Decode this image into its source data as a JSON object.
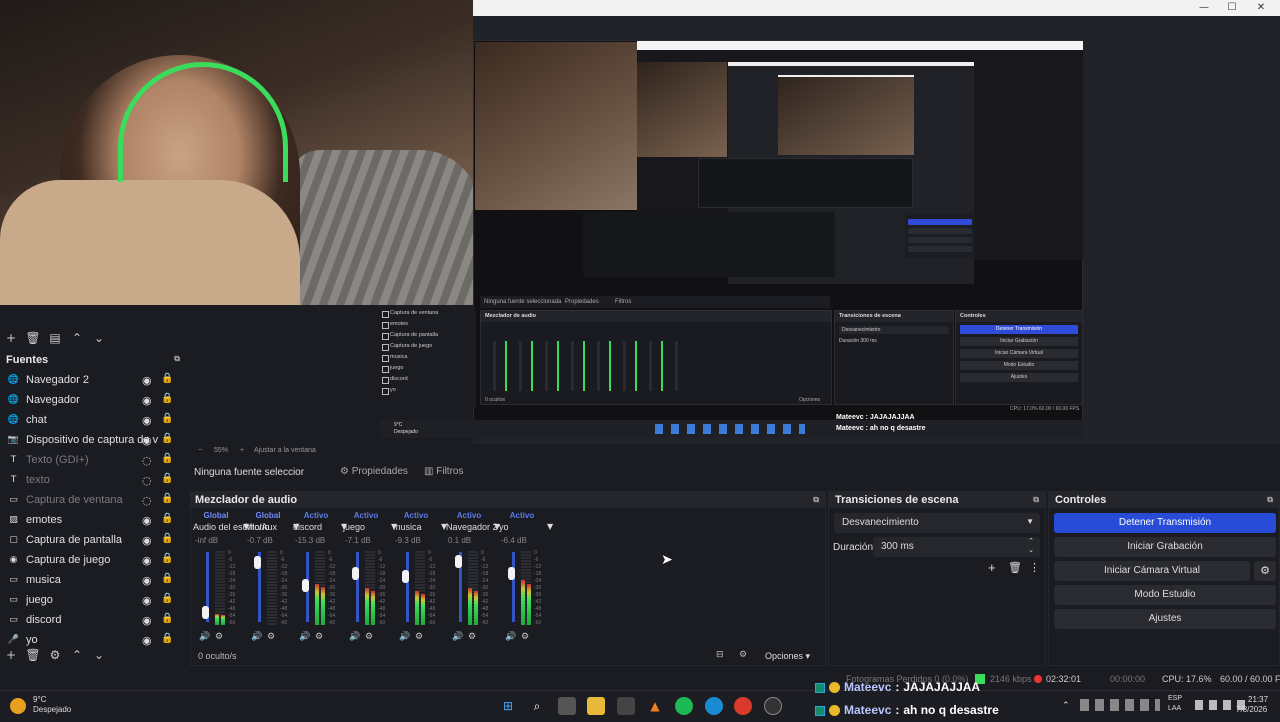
{
  "window": {
    "controls": {
      "minimize": "—",
      "maximize": "☐",
      "close": "✕"
    }
  },
  "preview": {
    "zoom_label": "55%",
    "fit_label": "Ajustar a la ventana"
  },
  "mini": {
    "no_source": "Ninguna fuente seleccionada",
    "properties": "Propiedades",
    "filters": "Filtros",
    "mixer_title": "Mezclador de audio",
    "trans_title": "Transiciones de escena",
    "trans_value": "Desvanecimiento",
    "duration": "Duración",
    "duration_value": "300 ms",
    "controls_title": "Controles",
    "controls": [
      "Detener Transmisión",
      "Iniciar Grabación",
      "Iniciar Cámara Virtual",
      "Modo Estudio",
      "Ajustes"
    ],
    "sources": [
      "Captura de ventana",
      "emotes",
      "Captura de pantalla",
      "Captura de juego",
      "musica",
      "juego",
      "discord",
      "yo"
    ],
    "hidden": "0 ocultos",
    "options": "Opciones",
    "status": "CPU: 17.0%   60.00 / 60.00 FPS",
    "weather": "9°C",
    "weather_desc": "Despejado",
    "chat": [
      {
        "user": "Mateevc",
        "msg": "JAJAJAJJAA"
      },
      {
        "user": "Mateevc",
        "msg": "ah no q desastre"
      }
    ]
  },
  "sources": {
    "title": "Fuentes",
    "items": [
      {
        "name": "Navegador 2",
        "icon": "globe-icon",
        "dim": false
      },
      {
        "name": "Navegador",
        "icon": "globe-icon",
        "dim": false
      },
      {
        "name": "chat",
        "icon": "globe-icon",
        "dim": false
      },
      {
        "name": "Dispositivo de captura de video",
        "icon": "camera-icon",
        "dim": false
      },
      {
        "name": "Texto (GDI+)",
        "icon": "text-icon",
        "dim": true
      },
      {
        "name": "texto",
        "icon": "text-icon",
        "dim": true
      },
      {
        "name": "Captura de ventana",
        "icon": "window-icon",
        "dim": true
      },
      {
        "name": "emotes",
        "icon": "image-icon",
        "dim": false
      },
      {
        "name": "Captura de pantalla",
        "icon": "monitor-icon",
        "dim": false
      },
      {
        "name": "Captura de juego",
        "icon": "gamepad-icon",
        "dim": false
      },
      {
        "name": "musica",
        "icon": "window-icon",
        "dim": false
      },
      {
        "name": "juego",
        "icon": "window-icon",
        "dim": false
      },
      {
        "name": "discord",
        "icon": "window-icon",
        "dim": false
      },
      {
        "name": "yo",
        "icon": "mic-icon",
        "dim": false
      }
    ]
  },
  "propbar": {
    "no_source": "Ninguna fuente seleccionada",
    "properties": "Propiedades",
    "filters": "Filtros"
  },
  "mixer": {
    "title": "Mezclador de audio",
    "channels": [
      {
        "tag": "Global",
        "label": "Audio del escritorio",
        "db": "-inf dB",
        "level": 0.15,
        "fader": 0.1
      },
      {
        "tag": "Global",
        "label": "Mic/Aux",
        "db": "-0.7 dB",
        "level": 0.0,
        "fader": 0.93
      },
      {
        "tag": "Activo",
        "label": "discord",
        "db": "-15.3 dB",
        "level": 0.55,
        "fader": 0.55
      },
      {
        "tag": "Activo",
        "label": "juego",
        "db": "-7.1 dB",
        "level": 0.5,
        "fader": 0.75
      },
      {
        "tag": "Activo",
        "label": "musica",
        "db": "-9.3 dB",
        "level": 0.45,
        "fader": 0.7
      },
      {
        "tag": "Activo",
        "label": "Navegador 2",
        "db": "0.1 dB",
        "level": 0.5,
        "fader": 0.95
      },
      {
        "tag": "Activo",
        "label": "yo",
        "db": "-6.4 dB",
        "level": 0.6,
        "fader": 0.75
      }
    ],
    "hidden": "0 oculto/s",
    "options": "Opciones",
    "scale": [
      "0",
      "-6",
      "-12",
      "-18",
      "-24",
      "-30",
      "-36",
      "-42",
      "-48",
      "-54",
      "-60"
    ]
  },
  "transitions": {
    "title": "Transiciones de escena",
    "value": "Desvanecimiento",
    "duration_label": "Duración",
    "duration_value": "300 ms"
  },
  "controls": {
    "title": "Controles",
    "buttons": [
      "Detener Transmisión",
      "Iniciar Grabación",
      "Iniciar Cámara Virtual",
      "Modo Estudio",
      "Ajustes"
    ]
  },
  "status": {
    "dropped": "Fotogramas Perdidos 0 (0.0%)",
    "bitrate": "2146 kbps",
    "live": "02:32:01",
    "rec": "00:00:00",
    "cpu": "CPU: 17.6%",
    "fps": "60.00 / 60.00 FPS"
  },
  "chat": [
    {
      "user": "Mateevc",
      "msg": "JAJAJAJJAA"
    },
    {
      "user": "Mateevc",
      "msg": "ah no q desastre"
    }
  ],
  "taskbar": {
    "temp": "9°C",
    "weather": "Despejado",
    "lang": "ESP",
    "layout": "LAA",
    "time": "21:37",
    "date": "7/8/2026"
  },
  "colors": {
    "accent": "#284cd8",
    "live_green": "#3bdc5c"
  }
}
